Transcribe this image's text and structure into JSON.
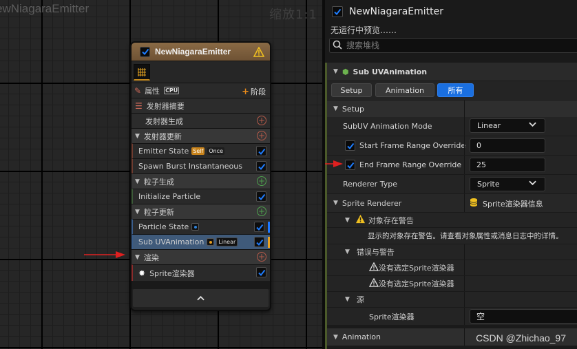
{
  "graph": {
    "title": "ewNiagaraEmitter",
    "zoom": "缩放1:1"
  },
  "node": {
    "title": "NewNiagaraEmitter",
    "attributes_label": "属性",
    "cpu_label": "CPU",
    "stage_label": "阶段",
    "rows": {
      "emitter_summary": "发射器摘要",
      "emitter_spawn": "发射器生成",
      "emitter_update": "发射器更新",
      "emitter_state": "Emitter State",
      "self_tag": "Self",
      "once_tag": "Once",
      "spawn_burst": "Spawn Burst Instantaneous",
      "particle_spawn": "粒子生成",
      "init_particle": "Initialize Particle",
      "particle_update": "粒子更新",
      "particle_state": "Particle State",
      "sub_uv": "Sub UVAnimation",
      "linear_tag": "Linear",
      "render": "渲染",
      "sprite_renderer": "Sprite渲染器"
    },
    "collapse_label": "⌃"
  },
  "details": {
    "title": "NewNiagaraEmitter",
    "subtitle": "无运行中预览……",
    "search_placeholder": "搜索堆栈",
    "module_header": "Sub UVAnimation",
    "tabs": [
      "Setup",
      "Animation",
      "所有"
    ],
    "setup_category": "Setup",
    "props": {
      "mode_label": "SubUV Animation Mode",
      "mode_value": "Linear",
      "start_override_label": "Start Frame Range Override",
      "start_override_value": "0",
      "end_override_label": "End Frame Range Override",
      "end_override_value": "25",
      "renderer_type_label": "Renderer Type",
      "renderer_type_value": "Sprite",
      "sprite_renderer_label": "Sprite Renderer",
      "sprite_renderer_value": "Sprite渲染器信息",
      "obj_warning_label": "对象存在警告",
      "obj_warning_text": "显示的对象存在警告。请查看对象属性或消息日志中的详情。",
      "errors_label": "错误与警告",
      "no_sprite_1": "没有选定Sprite渲染器",
      "no_sprite_2": "没有选定Sprite渲染器",
      "source_label": "源",
      "sprite_src_label": "Sprite渲染器",
      "sprite_src_value": "空",
      "animation_category": "Animation"
    },
    "watermark": "CSDN @Zhichao_97"
  },
  "colors": {
    "accent_blue": "#1a6fe0",
    "header_brown": "#7a5c3c",
    "warning_yellow": "#f0c020",
    "arrow_red": "#e02020"
  }
}
